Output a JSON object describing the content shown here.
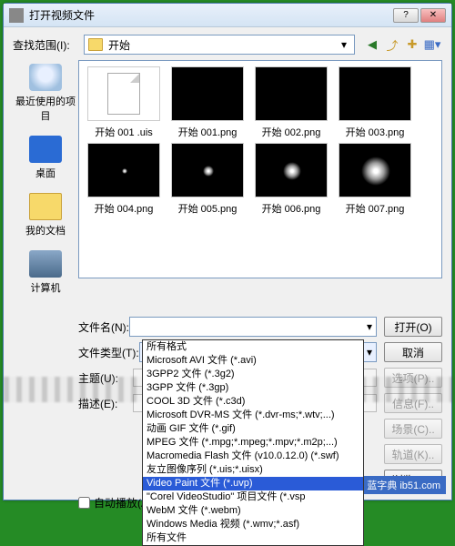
{
  "titlebar": {
    "title": "打开视频文件"
  },
  "lookin": {
    "label": "查找范围(I):",
    "value": "开始"
  },
  "sidebar": {
    "recent": "最近使用的项目",
    "desktop": "桌面",
    "docs": "我的文档",
    "computer": "计算机"
  },
  "files": [
    {
      "name": "开始 001 .uis",
      "kind": "doc"
    },
    {
      "name": "开始 001.png",
      "kind": "black",
      "glow": 0
    },
    {
      "name": "开始 002.png",
      "kind": "black",
      "glow": 0
    },
    {
      "name": "开始 003.png",
      "kind": "black",
      "glow": 0
    },
    {
      "name": "开始 004.png",
      "kind": "black",
      "glow": 6
    },
    {
      "name": "开始 005.png",
      "kind": "black",
      "glow": 12
    },
    {
      "name": "开始 006.png",
      "kind": "black",
      "glow": 20
    },
    {
      "name": "开始 007.png",
      "kind": "black",
      "glow": 32
    }
  ],
  "filename": {
    "label": "文件名(N):",
    "value": ""
  },
  "filetype": {
    "label": "文件类型(T):",
    "value": "所有文件"
  },
  "buttons": {
    "open": "打开(O)",
    "cancel": "取消",
    "options": "选项(P)..",
    "info": "信息(F)..",
    "scene": "场景(C)..",
    "tracks": "轨道(K)..",
    "browse": "浏览(B).."
  },
  "extras": {
    "subject_label": "主题(U):",
    "desc_label": "描述(E):",
    "autoplay": "自动播放(A)"
  },
  "filetype_options": [
    "所有格式",
    "Microsoft AVI 文件 (*.avi)",
    "3GPP2 文件 (*.3g2)",
    "3GPP 文件 (*.3gp)",
    "COOL 3D 文件 (*.c3d)",
    "Microsoft DVR-MS 文件 (*.dvr-ms;*.wtv;...)",
    "动画 GIF 文件 (*.gif)",
    "MPEG 文件 (*.mpg;*.mpeg;*.mpv;*.m2p;...)",
    "Macromedia Flash 文件 (v10.0.12.0) (*.swf)",
    "友立图像序列          (*.uis;*.uisx)",
    "Video Paint 文件 (*.uvp)",
    "\"Corel VideoStudio\" 项目文件 (*.vsp",
    "WebM 文件 (*.webm)",
    "Windows Media 视频 (*.wmv;*.asf)",
    "所有文件"
  ],
  "selected_option_index": 10,
  "watermark": "蓝字典 ib51.com"
}
